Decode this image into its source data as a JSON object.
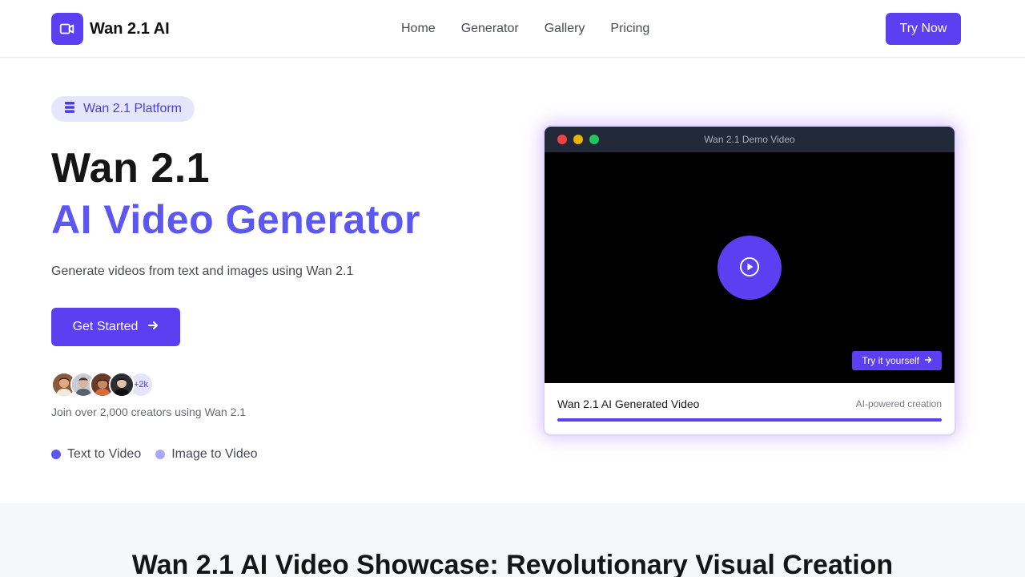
{
  "header": {
    "logo_text": "Wan 2.1 AI",
    "nav": [
      "Home",
      "Generator",
      "Gallery",
      "Pricing"
    ],
    "cta": "Try Now"
  },
  "hero": {
    "badge": "Wan 2.1 Platform",
    "title_line1": "Wan 2.1",
    "title_line2": "AI Video Generator",
    "subtitle": "Generate videos from text and images using Wan 2.1",
    "cta": "Get Started",
    "avatar_more": "+2k",
    "join_text": "Join over 2,000 creators using Wan 2.1",
    "modes": [
      {
        "label": "Text to Video",
        "color": "#5b57f0"
      },
      {
        "label": "Image to Video",
        "color": "#a9a8f7"
      }
    ]
  },
  "video_card": {
    "window_title": "Wan 2.1 Demo Video",
    "try_label": "Try it yourself",
    "video_title": "Wan 2.1 AI Generated Video",
    "ai_label": "AI-powered creation",
    "progress": 1.0
  },
  "showcase": {
    "title": "Wan 2.1 AI Video Showcase: Revolutionary Visual Creation"
  },
  "colors": {
    "accent": "#5b3ff0",
    "accent_light": "#5b57f0"
  }
}
